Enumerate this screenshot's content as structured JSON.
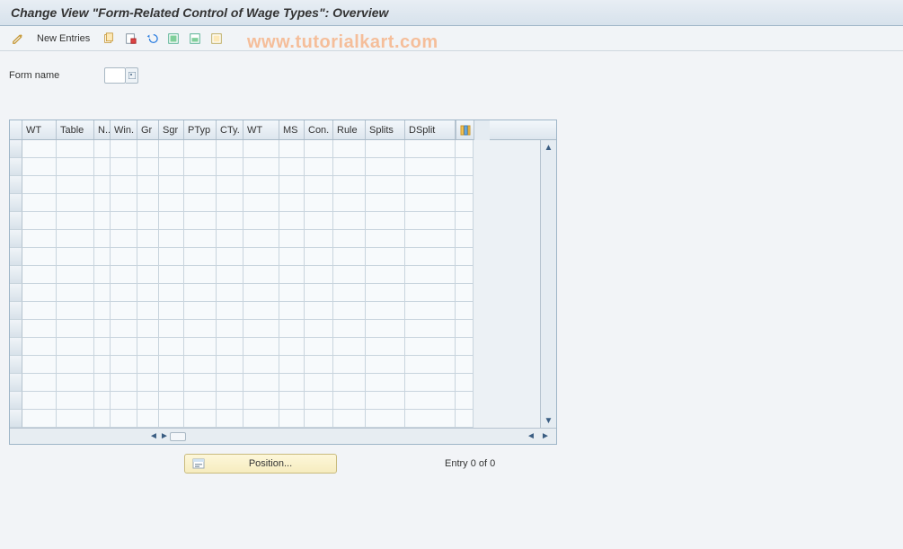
{
  "title": "Change View \"Form-Related Control of Wage Types\": Overview",
  "toolbar": {
    "new_entries": "New Entries"
  },
  "watermark": "www.tutorialkart.com",
  "form": {
    "name_label": "Form name",
    "name_value": ""
  },
  "grid": {
    "columns": [
      "WT",
      "Table",
      "N..",
      "Win.",
      "Gr",
      "Sgr",
      "PTyp",
      "CTy.",
      "WT",
      "MS",
      "Con.",
      "Rule",
      "Splits",
      "DSplit"
    ],
    "rows": 16
  },
  "footer": {
    "position_label": "Position...",
    "entry_text": "Entry 0 of 0"
  }
}
